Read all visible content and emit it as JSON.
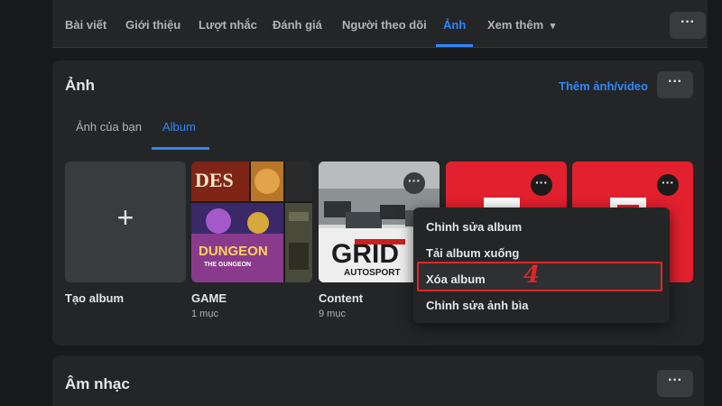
{
  "nav": {
    "tabs": [
      "Bài viết",
      "Giới thiệu",
      "Lượt nhắc",
      "Đánh giá",
      "Người theo dõi",
      "Ảnh"
    ],
    "more_label": "Xem thêm",
    "more_arrow": "▾",
    "active_tab": "Ảnh",
    "options_label": "···"
  },
  "photos": {
    "title": "Ảnh",
    "add_link": "Thêm ảnh/video",
    "options_label": "···",
    "subtabs": [
      "Ảnh của bạn",
      "Album"
    ],
    "active_subtab": "Album",
    "create_album": {
      "label": "Tạo album",
      "icon": "+"
    },
    "albums": [
      {
        "name": "GAME",
        "count": "1 mục"
      },
      {
        "name": "Content",
        "count": "9 mục"
      }
    ],
    "tile_options": "···",
    "grid_logo": "GRID",
    "grid_sub": "AUTOSPORT",
    "game_text_1": "DES",
    "game_text_2": "DUNGEON",
    "game_text_3": "THE GUNGEON"
  },
  "context_menu": {
    "items": [
      "Chỉnh sửa album",
      "Tải album xuống",
      "Xóa album",
      "Chỉnh sửa ảnh bìa"
    ],
    "highlighted": "Xóa album",
    "step_number": "4"
  },
  "music": {
    "title": "Âm nhạc",
    "options_label": "···"
  },
  "colors": {
    "background": "#18191a",
    "card": "#242526",
    "accent": "#2d88ff",
    "highlight": "#e0262b"
  }
}
